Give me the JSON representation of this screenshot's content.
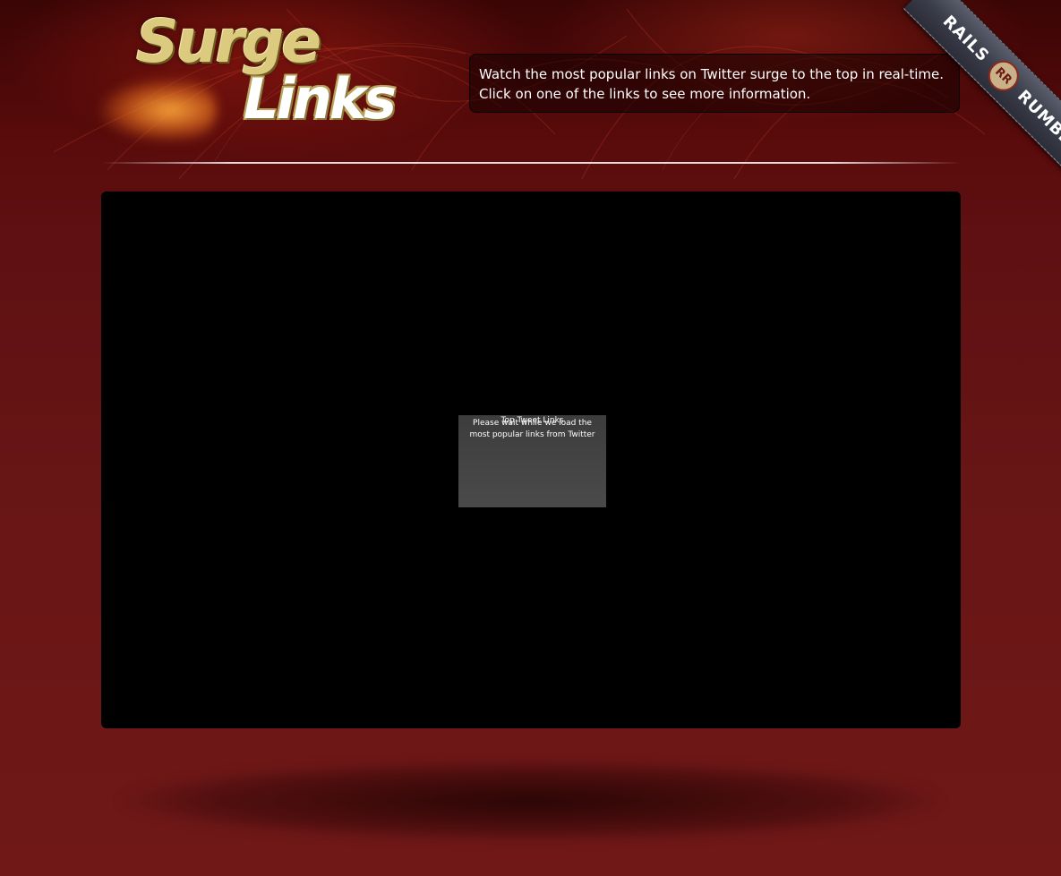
{
  "header": {
    "logo_word_1": "Surge",
    "logo_word_2": "Links",
    "tagline_line_1": "Watch the most popular links on Twitter surge to the top in real-time.",
    "tagline_line_2": "Click on one of the links to see more information."
  },
  "ribbon": {
    "left_text": "RAILS",
    "badge_text": "RR",
    "right_text": "RUMBLE"
  },
  "stage": {
    "loading_title": "Top Tweet Links",
    "loading_message": "Please wait while we load the most popular links from Twitter"
  },
  "colors": {
    "background_top": "#3a0505",
    "background_bottom": "#701818",
    "stage": "#000000",
    "loading_box": "#444444",
    "logo_gold": "#dccb7e",
    "ribbon": "#3b3e4b"
  }
}
